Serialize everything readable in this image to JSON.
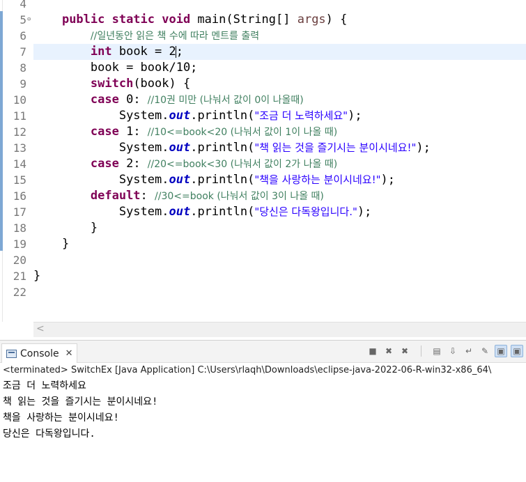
{
  "editor": {
    "line_numbers": [
      "4",
      "5",
      "6",
      "7",
      "8",
      "9",
      "10",
      "11",
      "12",
      "13",
      "14",
      "15",
      "16",
      "17",
      "18",
      "19",
      "20",
      "21",
      "22"
    ],
    "code": {
      "l5": {
        "kw1": "public static void",
        "text": " main(String[] ",
        "param": "args",
        "end": ") {"
      },
      "l6": {
        "comment": "//일년동안 읽은 책 수에 따라 멘트를 출력"
      },
      "l7": {
        "kw": "int",
        "text_before_caret": " book = 2",
        "text_after_caret": ";"
      },
      "l8": {
        "text": "book = book/10;"
      },
      "l9": {
        "kw": "switch",
        "text": "(book) {"
      },
      "l10": {
        "kw": "case",
        "text": " 0: ",
        "comment": "//10권 미만 (나눠서 값이 0이 나올때)"
      },
      "l11": {
        "pre": "System.",
        "field": "out",
        "mid": ".println(",
        "string": "\"조금 더 노력하세요\"",
        "end": ");"
      },
      "l12": {
        "kw": "case",
        "text": " 1: ",
        "comment": "//10<=book<20 (나눠서 값이 1이 나올 때)"
      },
      "l13": {
        "pre": "System.",
        "field": "out",
        "mid": ".println(",
        "string": "\"책 읽는 것을 즐기시는 분이시네요!\"",
        "end": ");"
      },
      "l14": {
        "kw": "case",
        "text": " 2: ",
        "comment": "//20<=book<30 (나눠서 값이 2가 나올 때)"
      },
      "l15": {
        "pre": "System.",
        "field": "out",
        "mid": ".println(",
        "string": "\"책을 사랑하는 분이시네요!\"",
        "end": ");"
      },
      "l16": {
        "kw": "default",
        "text": ": ",
        "comment": "//30<=book (나눠서 값이 3이 나올 때)"
      },
      "l17": {
        "pre": "System.",
        "field": "out",
        "mid": ".println(",
        "string": "\"당신은 다독왕입니다.\"",
        "end": ");"
      },
      "l18": {
        "text": "}"
      },
      "l19": {
        "text": "}"
      },
      "l21": {
        "text": "}"
      }
    }
  },
  "console": {
    "tab_label": "Console",
    "terminated": "<terminated> SwitchEx [Java Application] C:\\Users\\rlaqh\\Downloads\\eclipse-java-2022-06-R-win32-x86_64\\",
    "output": [
      "조금 더 노력하세요",
      "책 읽는 것을 즐기시는 분이시네요!",
      "책을 사랑하는 분이시네요!",
      "당신은 다독왕입니다."
    ]
  }
}
